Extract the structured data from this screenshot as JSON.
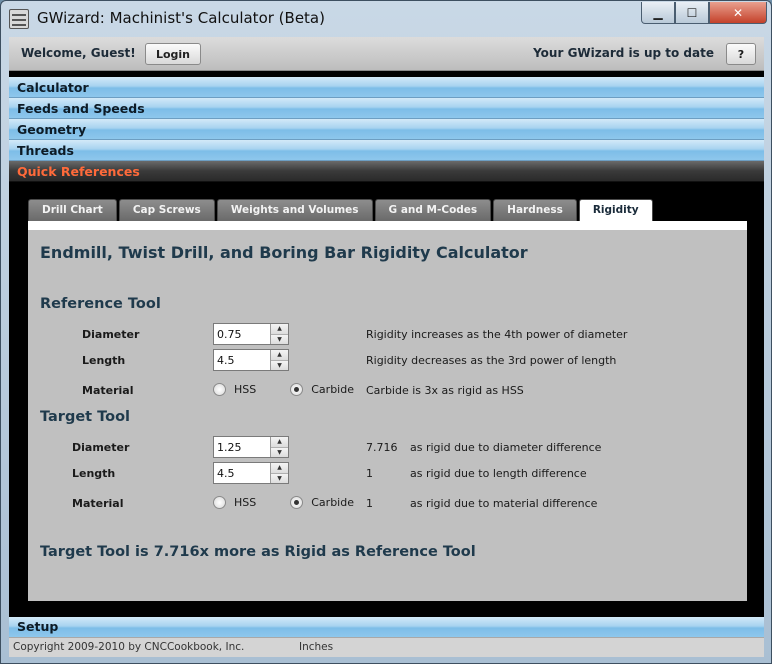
{
  "window": {
    "title": "GWizard: Machinist's Calculator (Beta)",
    "minimize": "▁",
    "maximize": "☐",
    "close": "✕"
  },
  "header": {
    "welcome": "Welcome, Guest!",
    "login_label": "Login",
    "status": "Your GWizard is up to date",
    "help_label": "?"
  },
  "sections": {
    "calculator": "Calculator",
    "feeds_speeds": "Feeds and Speeds",
    "geometry": "Geometry",
    "threads": "Threads",
    "quick_references": "Quick References",
    "setup": "Setup"
  },
  "tabs": [
    "Drill Chart",
    "Cap Screws",
    "Weights and Volumes",
    "G and M-Codes",
    "Hardness",
    "Rigidity"
  ],
  "active_tab": "Rigidity",
  "panel": {
    "title": "Endmill, Twist Drill, and Boring Bar Rigidity Calculator",
    "reference": {
      "heading": "Reference Tool",
      "diameter_label": "Diameter",
      "diameter_value": "0.75",
      "diameter_note": "Rigidity increases as the 4th power of diameter",
      "length_label": "Length",
      "length_value": "4.5",
      "length_note": "Rigidity decreases as the 3rd power of length",
      "material_label": "Material",
      "opt_hss": "HSS",
      "opt_carbide": "Carbide",
      "material_note": "Carbide is 3x as rigid as HSS"
    },
    "target": {
      "heading": "Target Tool",
      "diameter_label": "Diameter",
      "diameter_value": "1.25",
      "diameter_factor": "7.716",
      "diameter_note": "as rigid due to diameter difference",
      "length_label": "Length",
      "length_value": "4.5",
      "length_factor": "1",
      "length_note": "as rigid due to length difference",
      "material_label": "Material",
      "opt_hss": "HSS",
      "opt_carbide": "Carbide",
      "material_factor": "1",
      "material_note": "as rigid due to material difference"
    },
    "result": "Target Tool is 7.716x more as Rigid as Reference Tool"
  },
  "footer": {
    "copyright": "Copyright 2009-2010 by CNCCookbook, Inc.",
    "units": "Inches"
  }
}
